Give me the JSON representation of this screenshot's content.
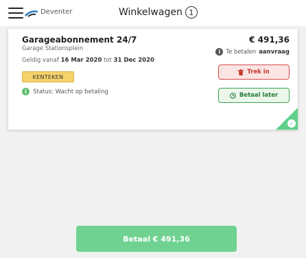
{
  "header": {
    "city": "Deventer",
    "title": "Winkelwagen",
    "cart_count": "1"
  },
  "cart_item": {
    "name": "Garageabonnement 24/7",
    "location": "Garage Stationsplein",
    "validity_prefix": "Geldig vanaf",
    "valid_from": "16 Mar 2020",
    "validity_mid": "tot",
    "valid_to": "31 Dec 2020",
    "plate_label": "KENTEKEN",
    "status_text": "Status: Wacht op betaling",
    "price": "€ 491,36",
    "pay_info_prefix": "Te betalen",
    "pay_info_bold": "aanvraag",
    "withdraw_label": "Trek in",
    "pay_later_label": "Betaal later"
  },
  "footer": {
    "pay_button": "Betaal € 491,36"
  },
  "colors": {
    "accent_green": "#6fd291",
    "danger_red": "#d64a4a",
    "plate_yellow": "#f5d26a",
    "status_green": "#5fbf6e",
    "info_dark": "#555555"
  },
  "icons": {
    "menu": "hamburger-icon",
    "logo": "swoosh-logo",
    "info": "info-icon",
    "trash": "trash-icon",
    "clock": "clock-icon",
    "check": "check-icon"
  }
}
